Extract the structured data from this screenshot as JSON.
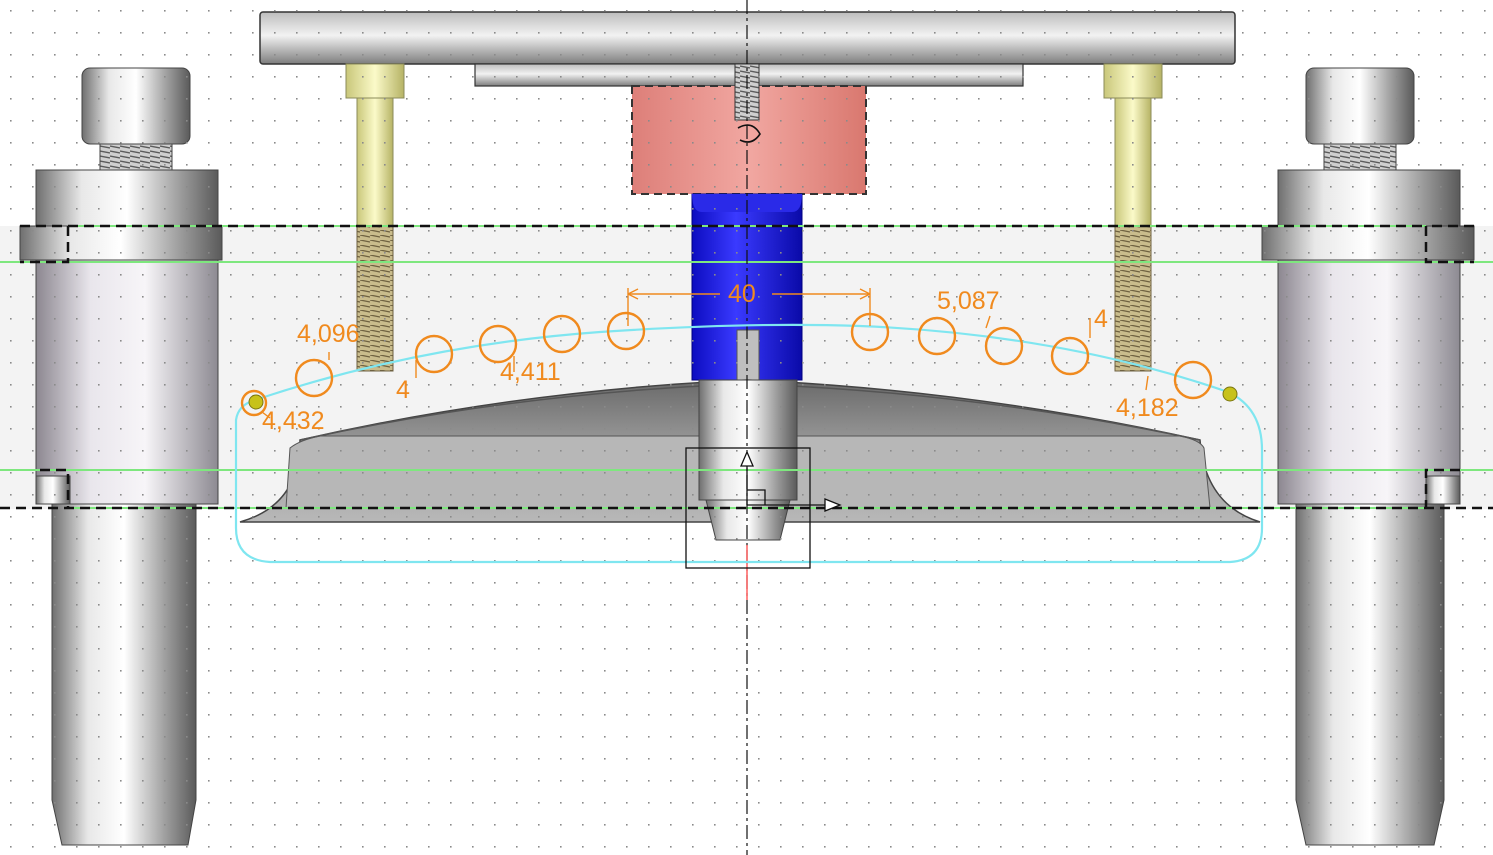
{
  "sketch": {
    "dimensions": {
      "center_spacing": "40",
      "d_4096": "4,096",
      "d_4_left": "4",
      "d_4411": "4,411",
      "d_4432": "4,432",
      "d_5087": "5,087",
      "d_4_right": "4",
      "d_4182": "4,182"
    },
    "hole_count": 12
  },
  "colors": {
    "dimension": "#f08a1e",
    "profile": "#7fe6f0",
    "construction": "#7ee77e",
    "die_insert": "#e8837c",
    "punch": "#1f1fe0",
    "bolt_head": "#f1f0a0",
    "grid_dot": "#8a8a8a"
  }
}
